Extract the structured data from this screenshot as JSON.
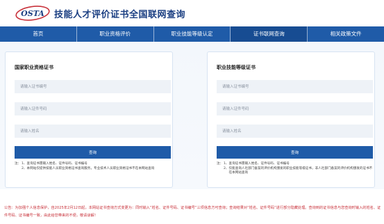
{
  "header": {
    "logo_text": "OSTA",
    "title": "技能人才评价证书全国联网查询"
  },
  "nav": {
    "items": [
      {
        "label": "首页"
      },
      {
        "label": "职业资格评价"
      },
      {
        "label": "职业技能等级认定"
      },
      {
        "label": "证书联网查询"
      },
      {
        "label": "相关政策文件"
      }
    ]
  },
  "left_card": {
    "title": "国家职业资格证书",
    "cert_no_placeholder": "请输入证书编号",
    "id_placeholder": "请输入证件号码",
    "name_placeholder": "请输入姓名",
    "query_label": "查询",
    "notes_prefix": "注：",
    "notes": [
      {
        "num": "1、",
        "text": "查询证书需输入姓名、证件号码、证书编号"
      },
      {
        "num": "2、",
        "text": "本网站仅提供技能人员职业资格证书查询服务，专业技术人员职业资格证书不在本网站查询"
      }
    ]
  },
  "right_card": {
    "title": "职业技能等级证书",
    "cert_no_placeholder": "请输入证书编号",
    "id_placeholder": "请输入证件号码",
    "name_placeholder": "请输入姓名",
    "query_label": "查询",
    "notes_prefix": "注：",
    "notes": [
      {
        "num": "1、",
        "text": "查询证书需输入姓名、证件号码、证书编号"
      },
      {
        "num": "2、",
        "text": "仅能查询人社部门备案的评价机构颁发的职业技能等级证书，非人社部门备案的评价机构颁发的证书不在本网站查询"
      }
    ]
  },
  "announcement": "公告：为加强个人信息保护，自2025年2月12日起，本网站证书查询方式变更为：同时输入“姓名、证件号码、证书编号”三项信息方可查询；查询结果对“姓名、证件号码”进行部分隐藏处理。查询到的证书信息与您查询时输入的姓名、证件号码、证书编号一致，由此给您带来的不便，敬请谅解！",
  "colors": {
    "nav_bg": "#1f5ba8",
    "title_blue": "#1b3f82",
    "announcement_red": "#c8323b"
  }
}
